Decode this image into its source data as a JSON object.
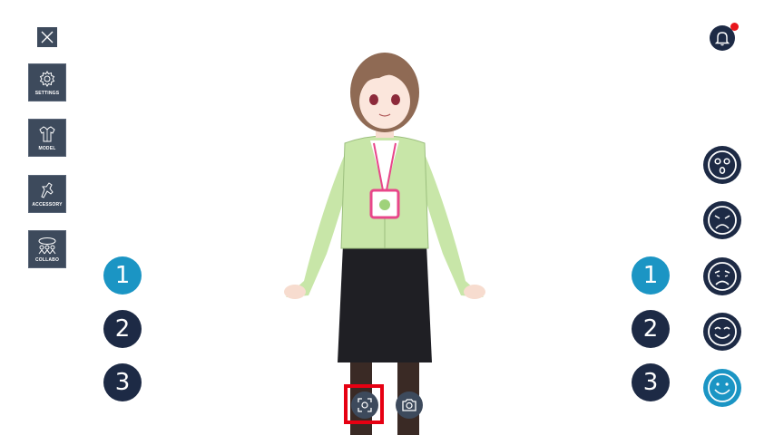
{
  "left_menu": {
    "close_icon": "close-icon",
    "items": [
      {
        "label": "SETTINGS",
        "icon": "gear-icon"
      },
      {
        "label": "MODEL",
        "icon": "shirt-icon"
      },
      {
        "label": "ACCESSORY",
        "icon": "ribbon-icon"
      },
      {
        "label": "COLLABO",
        "icon": "collabo-icon"
      }
    ]
  },
  "left_pose_buttons": [
    "1",
    "2",
    "3"
  ],
  "right_pose_buttons": [
    "1",
    "2",
    "3"
  ],
  "selected_pose": "1",
  "expressions": [
    {
      "name": "surprised-face-icon",
      "selected": false
    },
    {
      "name": "angry-face-icon",
      "selected": false
    },
    {
      "name": "sad-face-icon",
      "selected": false
    },
    {
      "name": "smiling-face-icon",
      "selected": false
    },
    {
      "name": "happy-face-icon",
      "selected": true
    }
  ],
  "bottom_controls": [
    "screenshot-area-icon",
    "camera-icon"
  ],
  "notification": {
    "icon": "bell-icon",
    "has_unread": true
  },
  "colors": {
    "accent": "#1b95c4",
    "navy": "#1d2a45",
    "panel": "#3d4a5c",
    "alert": "#e8161c",
    "highlight": "#e60012"
  }
}
